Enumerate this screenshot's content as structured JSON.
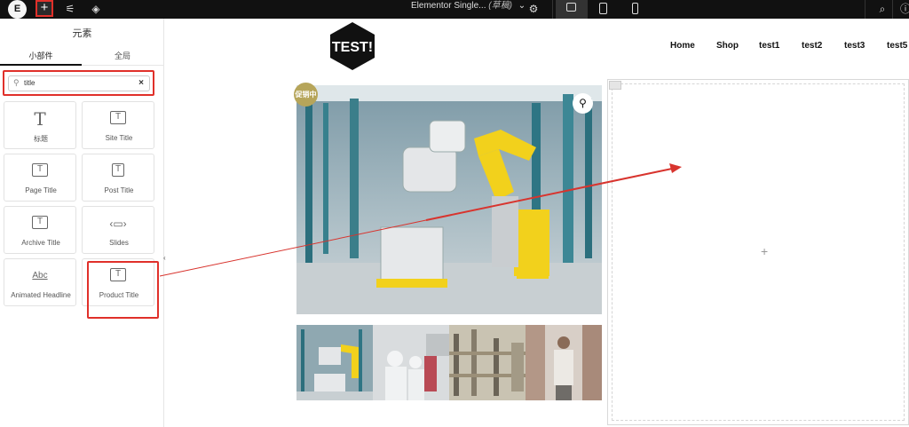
{
  "topbar": {
    "logo_text": "E",
    "add_label": "+",
    "document_title": "Elementor Single...",
    "document_status": "(草稿)",
    "icons": [
      "elementor-logo-icon",
      "add-element-icon",
      "settings-sliders-icon",
      "layers-icon",
      "chevron-down-icon",
      "gear-icon",
      "desktop-icon",
      "tablet-icon",
      "mobile-icon",
      "search-icon",
      "help-icon"
    ]
  },
  "panel": {
    "title": "元素",
    "tabs": [
      "小部件",
      "全局"
    ],
    "search": {
      "value": "title",
      "placeholder": ""
    },
    "widgets": [
      {
        "label": "标题",
        "icon": "heading-icon"
      },
      {
        "label": "Site Title",
        "icon": "site-title-icon"
      },
      {
        "label": "Page Title",
        "icon": "page-title-icon"
      },
      {
        "label": "Post Title",
        "icon": "post-title-icon"
      },
      {
        "label": "Archive Title",
        "icon": "archive-title-icon"
      },
      {
        "label": "Slides",
        "icon": "slides-icon"
      },
      {
        "label": "Animated Headline",
        "icon": "animated-headline-icon"
      },
      {
        "label": "Product Title",
        "icon": "product-title-icon"
      }
    ]
  },
  "site": {
    "logo_text": "TEST!",
    "nav": [
      "Home",
      "Shop",
      "test1",
      "test2",
      "test3",
      "test5"
    ],
    "badge": "促销中"
  },
  "colors": {
    "accent_red": "#e0302a",
    "topbar": "#111111",
    "badge": "#b6a55a",
    "robot_yellow": "#f2d11c"
  }
}
